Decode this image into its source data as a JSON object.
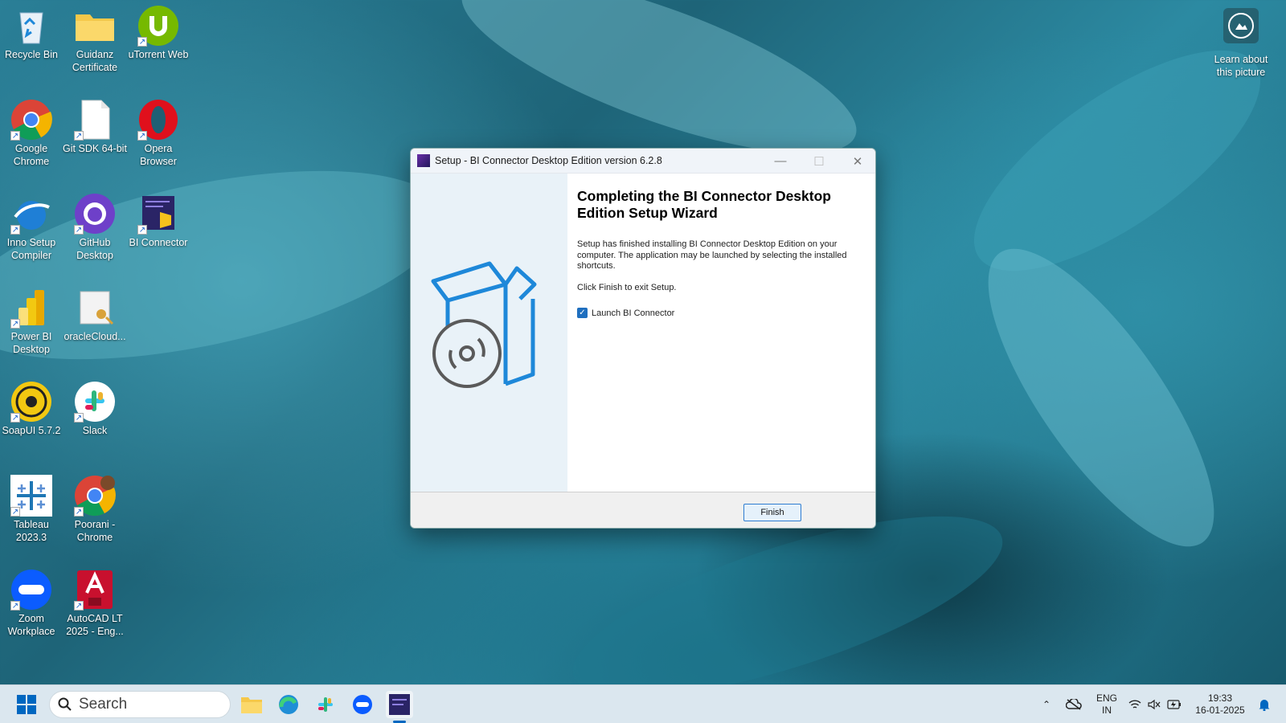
{
  "desktop": {
    "icons": [
      {
        "label": "Recycle Bin",
        "icon": "recycle-bin-icon"
      },
      {
        "label": "Guidanz Certificate",
        "icon": "folder-icon"
      },
      {
        "label": "uTorrent Web",
        "icon": "utorrent-icon"
      },
      {
        "label": "Google Chrome",
        "icon": "chrome-icon"
      },
      {
        "label": "Git SDK 64-bit",
        "icon": "file-icon"
      },
      {
        "label": "Opera Browser",
        "icon": "opera-icon"
      },
      {
        "label": "Inno Setup Compiler",
        "icon": "inno-setup-icon"
      },
      {
        "label": "GitHub Desktop",
        "icon": "github-icon"
      },
      {
        "label": "BI Connector",
        "icon": "bi-connector-icon"
      },
      {
        "label": "Power BI Desktop",
        "icon": "power-bi-icon"
      },
      {
        "label": "oracleCloud...",
        "icon": "certificate-file-icon"
      },
      {
        "label": "SoapUI 5.7.2",
        "icon": "soapui-icon"
      },
      {
        "label": "Slack",
        "icon": "slack-icon"
      },
      {
        "label": "Tableau 2023.3",
        "icon": "tableau-icon"
      },
      {
        "label": "Poorani - Chrome",
        "icon": "chrome-profile-icon"
      },
      {
        "label": "Zoom Workplace",
        "icon": "zoom-icon"
      },
      {
        "label": "AutoCAD LT 2025 - Eng...",
        "icon": "autocad-icon"
      }
    ],
    "learn_label": "Learn about this picture"
  },
  "window": {
    "title": "Setup - BI Connector Desktop Edition version 6.2.8",
    "heading": "Completing the BI Connector Desktop Edition Setup Wizard",
    "paragraph1": "Setup has finished installing BI Connector Desktop Edition on your computer. The application may be launched by selecting the installed shortcuts.",
    "paragraph2": "Click Finish to exit Setup.",
    "checkbox_label": "Launch BI Connector",
    "checkbox_checked": true,
    "finish_label": "Finish"
  },
  "taskbar": {
    "search_placeholder": "Search",
    "lang_top": "ENG",
    "lang_bottom": "IN",
    "time": "19:33",
    "date": "16-01-2025"
  }
}
